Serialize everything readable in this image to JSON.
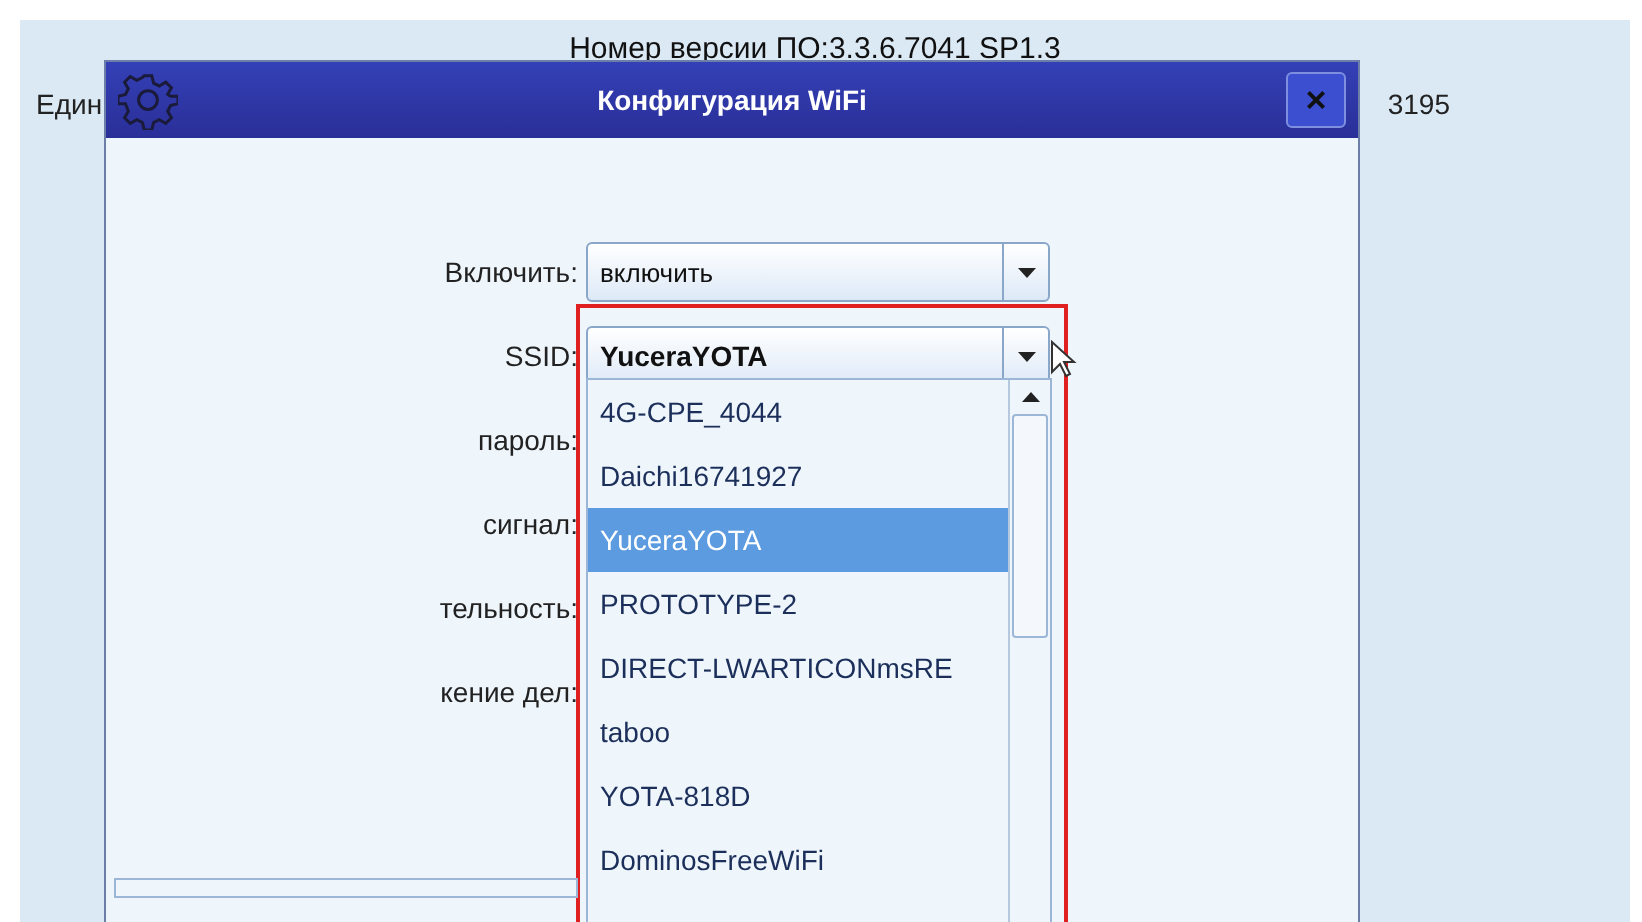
{
  "background": {
    "version_text": "Номер версии ПО:3.3.6.7041 SP1.3",
    "left_text": "Един",
    "right_text": "3195"
  },
  "dialog": {
    "title": "Конфигурация WiFi",
    "close": "×",
    "fields": [
      {
        "label": "Включить:",
        "value": "включить",
        "kind": "combo"
      },
      {
        "label": "SSID:",
        "value": "YuceraYOTA",
        "kind": "combo"
      },
      {
        "label": "пароль:",
        "kind": "hidden"
      },
      {
        "label": "сигнал:",
        "kind": "hidden"
      },
      {
        "label": "тельность:",
        "kind": "hidden"
      },
      {
        "label": "кение дел:",
        "kind": "hidden"
      }
    ],
    "ssid_list": [
      {
        "name": "4G-CPE_4044",
        "selected": false
      },
      {
        "name": "Daichi16741927",
        "selected": false
      },
      {
        "name": "YuceraYOTA",
        "selected": true
      },
      {
        "name": "PROTOTYPE-2",
        "selected": false
      },
      {
        "name": "DIRECT-LWARTICONmsRE",
        "selected": false
      },
      {
        "name": "taboo",
        "selected": false
      },
      {
        "name": "YOTA-818D",
        "selected": false
      },
      {
        "name": "DominosFreeWiFi",
        "selected": false
      }
    ]
  }
}
